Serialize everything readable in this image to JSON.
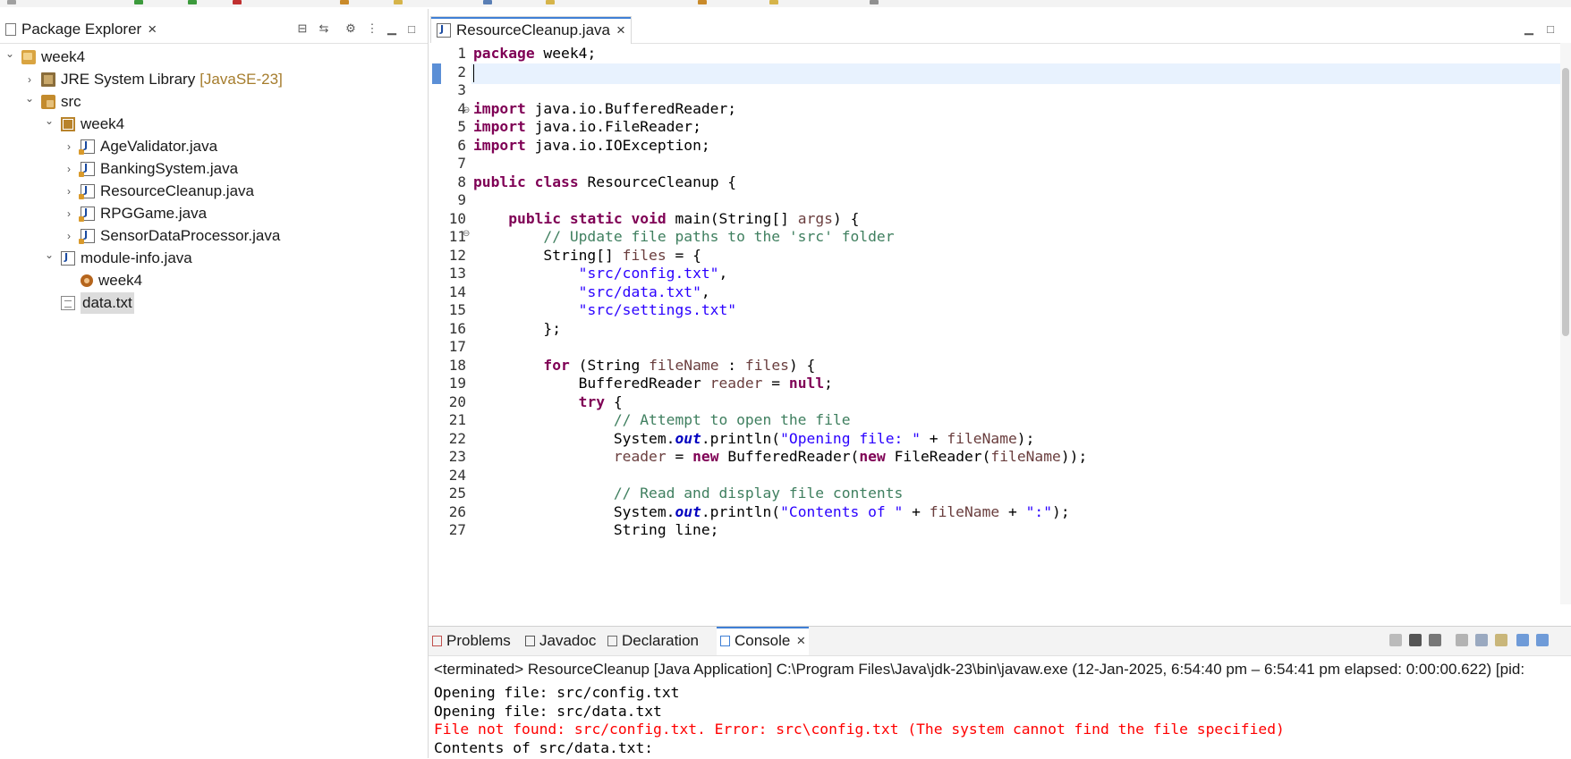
{
  "package_explorer": {
    "tab_label": "Package Explorer",
    "close_glyph": "×",
    "tree": [
      {
        "label": "week4",
        "icon": "project-icon",
        "twisty": "v",
        "indent": 0
      },
      {
        "label": "JRE System Library",
        "decor": "[JavaSE-23]",
        "icon": "library-icon",
        "twisty": ">",
        "indent": 1
      },
      {
        "label": "src",
        "icon": "source-folder-icon",
        "twisty": "v",
        "indent": 1
      },
      {
        "label": "week4",
        "icon": "package-icon",
        "twisty": "v",
        "indent": 2
      },
      {
        "label": "AgeValidator.java",
        "icon": "java-file-icon",
        "twisty": ">",
        "indent": 3
      },
      {
        "label": "BankingSystem.java",
        "icon": "java-file-icon",
        "twisty": ">",
        "indent": 3
      },
      {
        "label": "ResourceCleanup.java",
        "icon": "java-file-icon",
        "twisty": ">",
        "indent": 3
      },
      {
        "label": "RPGGame.java",
        "icon": "java-file-icon",
        "twisty": ">",
        "indent": 3
      },
      {
        "label": "SensorDataProcessor.java",
        "icon": "java-file-icon",
        "twisty": ">",
        "indent": 3
      },
      {
        "label": "module-info.java",
        "icon": "java-file-icon",
        "twisty": "v",
        "indent": 2
      },
      {
        "label": "week4",
        "icon": "module-icon",
        "twisty": "",
        "indent": 3
      },
      {
        "label": "data.txt",
        "icon": "text-file-icon",
        "twisty": "",
        "indent": 2,
        "selected": true
      }
    ]
  },
  "editor": {
    "tab_label": "ResourceCleanup.java",
    "close_glyph": "×",
    "line_numbers": [
      "1",
      "2",
      "3",
      "4",
      "5",
      "6",
      "7",
      "8",
      "9",
      "10",
      "11",
      "12",
      "13",
      "14",
      "15",
      "16",
      "17",
      "18",
      "19",
      "20",
      "21",
      "22",
      "23",
      "24",
      "25",
      "26",
      "27"
    ],
    "code": {
      "l1": [
        "package",
        " week4;"
      ],
      "l4": [
        "import",
        " java.io.BufferedReader;"
      ],
      "l5": [
        "import",
        " java.io.FileReader;"
      ],
      "l6": [
        "import",
        " java.io.IOException;"
      ],
      "l8": [
        "public",
        " ",
        "class",
        " ResourceCleanup {"
      ],
      "l10": [
        "    ",
        "public",
        " ",
        "static",
        " ",
        "void",
        " main(String[] ",
        "args",
        ") {"
      ],
      "l11": "        // Update file paths to the 'src' folder",
      "l12": [
        "        String[] ",
        "files",
        " = {"
      ],
      "l13": [
        "            ",
        "\"src/config.txt\"",
        ","
      ],
      "l14": [
        "            ",
        "\"src/data.txt\"",
        ","
      ],
      "l15": [
        "            ",
        "\"src/settings.txt\""
      ],
      "l16": "        };",
      "l18": [
        "        ",
        "for",
        " (String ",
        "fileName",
        " : ",
        "files",
        ") {"
      ],
      "l19": [
        "            BufferedReader ",
        "reader",
        " = ",
        "null",
        ";"
      ],
      "l20": [
        "            ",
        "try",
        " {"
      ],
      "l21": "                // Attempt to open the file",
      "l22": [
        "                System.",
        "out",
        ".println(",
        "\"Opening file: \"",
        " + ",
        "fileName",
        ");"
      ],
      "l23": [
        "                ",
        "reader",
        " = ",
        "new",
        " BufferedReader(",
        "new",
        " FileReader(",
        "fileName",
        "));"
      ],
      "l25": "                // Read and display file contents",
      "l26": [
        "                System.",
        "out",
        ".println(",
        "\"Contents of \"",
        " + ",
        "fileName",
        " + ",
        "\":\"",
        ");"
      ],
      "l27": "                String line;"
    }
  },
  "console_area": {
    "tabs": [
      {
        "label": "Problems",
        "icon": "problems-icon"
      },
      {
        "label": "Javadoc",
        "icon": "javadoc-icon"
      },
      {
        "label": "Declaration",
        "icon": "declaration-icon"
      },
      {
        "label": "Console",
        "icon": "console-icon",
        "active": true
      }
    ],
    "close_glyph": "×",
    "header": "<terminated> ResourceCleanup [Java Application] C:\\Program Files\\Java\\jdk-23\\bin\\javaw.exe  (12-Jan-2025, 6:54:40 pm – 6:54:41 pm elapsed: 0:00:00.622) [pid:",
    "output": [
      {
        "text": "Opening file: src/config.txt",
        "error": false
      },
      {
        "text": "Opening file: src/data.txt",
        "error": false
      },
      {
        "text": "File not found: src/config.txt. Error: src\\config.txt (The system cannot find the file specified)",
        "error": true
      },
      {
        "text": "Contents of src/data.txt:",
        "error": false
      }
    ]
  },
  "colors": {
    "keyword": "#7f0055",
    "string": "#2a00ff",
    "comment": "#3f7f5f",
    "static_field": "#0000c0",
    "local_var": "#6a3e3e",
    "error_text": "#ff0000",
    "current_line": "#e8f2fe",
    "selection": "#dcdcdc",
    "active_tab_accent": "#3f7fd5"
  }
}
